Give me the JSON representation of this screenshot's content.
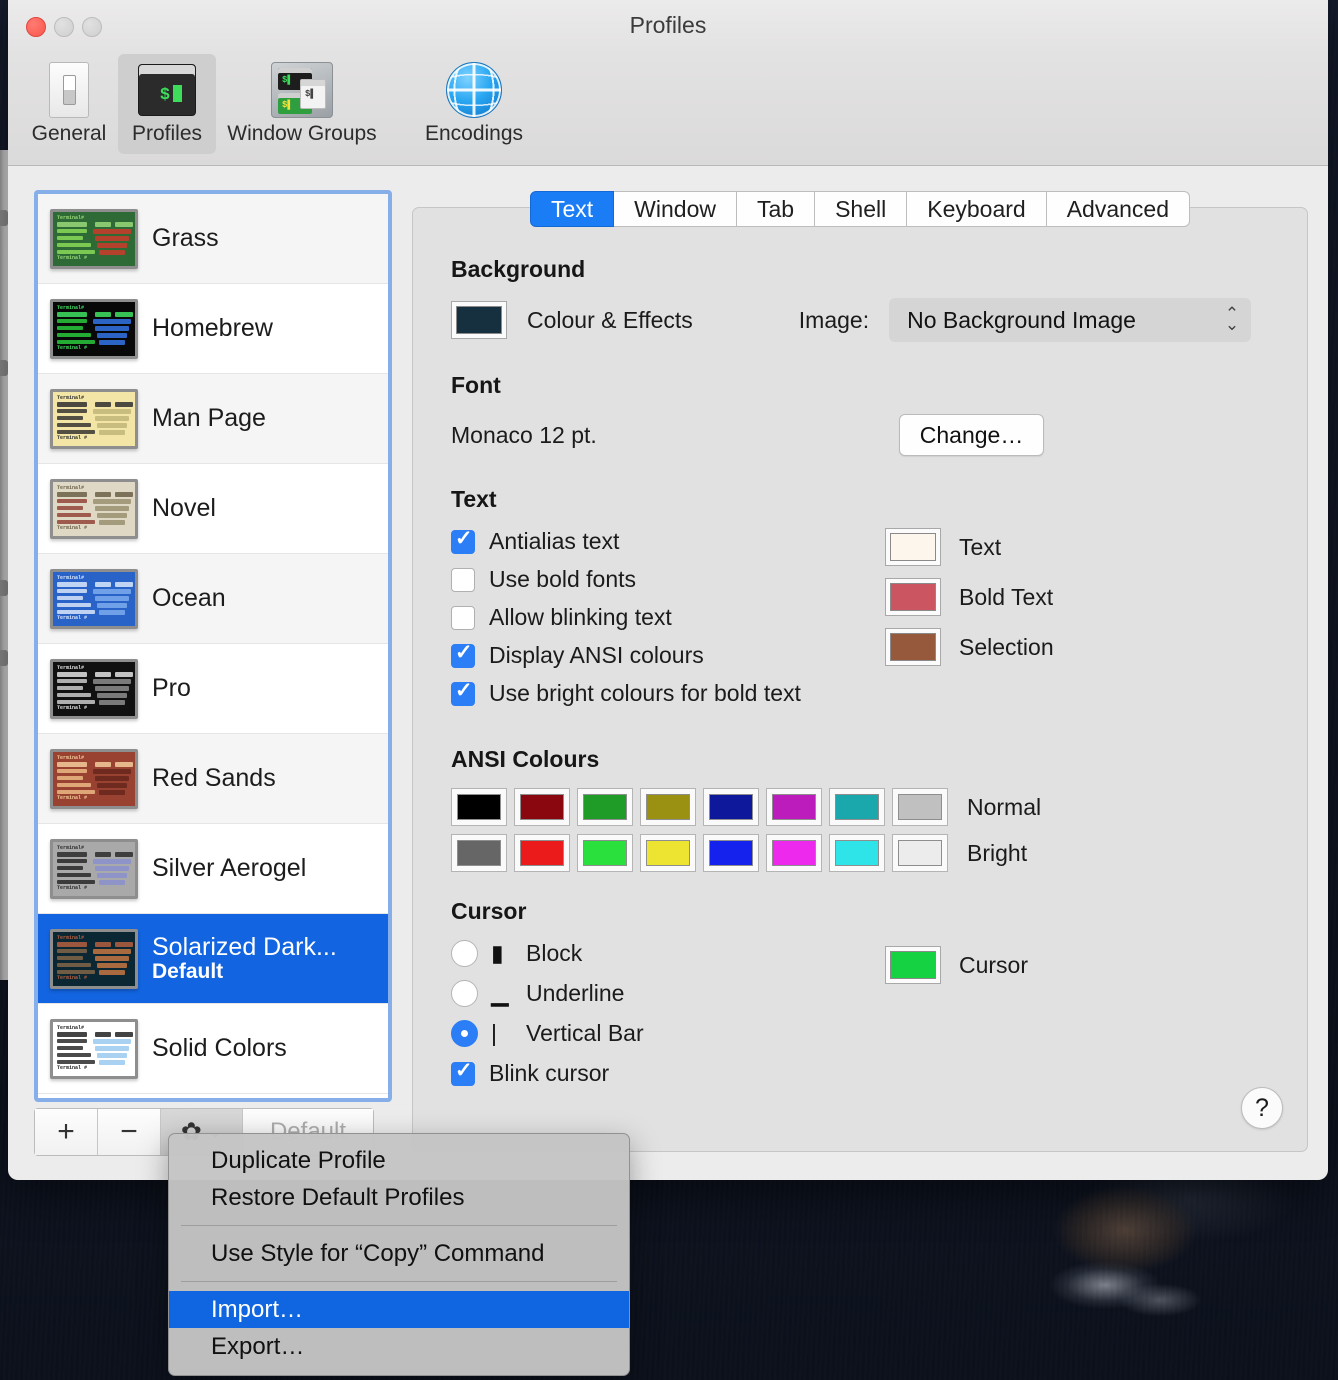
{
  "window": {
    "title": "Profiles"
  },
  "traffic_lights": [
    {
      "name": "close",
      "color": "#f9564c",
      "active": true
    },
    {
      "name": "minimize",
      "color": "#d2d2d2",
      "active": false
    },
    {
      "name": "zoom",
      "color": "#d2d2d2",
      "active": false
    }
  ],
  "toolbar": {
    "items": [
      {
        "label": "General",
        "icon": "general-switch-icon",
        "selected": false
      },
      {
        "label": "Profiles",
        "icon": "terminal-icon",
        "selected": true
      },
      {
        "label": "Window Groups",
        "icon": "window-groups-icon",
        "selected": false
      },
      {
        "label": "Encodings",
        "icon": "globe-icon",
        "selected": false
      }
    ]
  },
  "profile_list": {
    "items": [
      {
        "name": "Grass",
        "subtitle": "",
        "selected": false,
        "thumb": {
          "bg": "#2d6a35",
          "text": "#8fe05a",
          "accent": "#b4412c",
          "head": "#9bd87a"
        }
      },
      {
        "name": "Homebrew",
        "subtitle": "",
        "selected": false,
        "thumb": {
          "bg": "#080808",
          "text": "#2ad53f",
          "accent": "#2b64c4",
          "head": "#40e060"
        }
      },
      {
        "name": "Man Page",
        "subtitle": "",
        "selected": false,
        "thumb": {
          "bg": "#f3e5a6",
          "text": "#2a2a2a",
          "accent": "#c9bc7f",
          "head": "#2e2e2e"
        }
      },
      {
        "name": "Novel",
        "subtitle": "",
        "selected": false,
        "thumb": {
          "bg": "#dfd8c4",
          "text": "#8d3b2e",
          "accent": "#a49a7c",
          "head": "#6b5f46"
        }
      },
      {
        "name": "Ocean",
        "subtitle": "",
        "selected": false,
        "thumb": {
          "bg": "#2a63c8",
          "text": "#e6eefc",
          "accent": "#6fa0e8",
          "head": "#dbe7fb"
        }
      },
      {
        "name": "Pro",
        "subtitle": "",
        "selected": false,
        "thumb": {
          "bg": "#111111",
          "text": "#d6d6d6",
          "accent": "#7a7a7a",
          "head": "#e3e3e3"
        }
      },
      {
        "name": "Red Sands",
        "subtitle": "",
        "selected": false,
        "thumb": {
          "bg": "#9a4232",
          "text": "#f0c08a",
          "accent": "#6e2a1f",
          "head": "#f2cb9a"
        }
      },
      {
        "name": "Silver Aerogel",
        "subtitle": "",
        "selected": false,
        "thumb": {
          "bg": "#a9a9a9",
          "text": "#1f1f1f",
          "accent": "#8e93c8",
          "head": "#2b2b2b"
        }
      },
      {
        "name": "Solarized Dark...",
        "subtitle": "Default",
        "selected": true,
        "thumb": {
          "bg": "#0b2733",
          "text": "#8a6a4a",
          "accent": "#a86a3e",
          "head": "#b5603f"
        }
      },
      {
        "name": "Solid Colors",
        "subtitle": "",
        "selected": false,
        "thumb": {
          "bg": "#ffffff",
          "text": "#1e1e1e",
          "accent": "#a9d2f2",
          "head": "#222222"
        }
      }
    ],
    "toolbar": {
      "add_label": "+",
      "remove_label": "−",
      "gear_icon": "gear-icon",
      "chevron_icon": "chevron-down-icon",
      "default_label": "Default"
    }
  },
  "tabs": [
    {
      "label": "Text",
      "active": true
    },
    {
      "label": "Window",
      "active": false
    },
    {
      "label": "Tab",
      "active": false
    },
    {
      "label": "Shell",
      "active": false
    },
    {
      "label": "Keyboard",
      "active": false
    },
    {
      "label": "Advanced",
      "active": false
    }
  ],
  "background": {
    "heading": "Background",
    "colour_effects_label": "Colour & Effects",
    "colour_swatch": "#17303f",
    "image_label": "Image:",
    "image_value": "No Background Image"
  },
  "font": {
    "heading": "Font",
    "value": "Monaco 12 pt.",
    "change_label": "Change…"
  },
  "text": {
    "heading": "Text",
    "checkboxes": [
      {
        "label": "Antialias text",
        "checked": true
      },
      {
        "label": "Use bold fonts",
        "checked": false
      },
      {
        "label": "Allow blinking text",
        "checked": false
      },
      {
        "label": "Display ANSI colours",
        "checked": true
      },
      {
        "label": "Use bright colours for bold text",
        "checked": true
      }
    ],
    "colors": [
      {
        "label": "Text",
        "value": "#fdf6ec"
      },
      {
        "label": "Bold Text",
        "value": "#cb5560"
      },
      {
        "label": "Selection",
        "value": "#96593c"
      }
    ]
  },
  "ansi": {
    "heading": "ANSI Colours",
    "normal_label": "Normal",
    "bright_label": "Bright",
    "normal": [
      "#000000",
      "#8b0710",
      "#1f9b28",
      "#9a9112",
      "#0d189b",
      "#bc1cbc",
      "#1ba8ad",
      "#c0c0c0"
    ],
    "bright": [
      "#666666",
      "#ec1b1b",
      "#2ae03c",
      "#ece430",
      "#1522ed",
      "#ec29ec",
      "#2ee4e8",
      "#ececec"
    ]
  },
  "cursor": {
    "heading": "Cursor",
    "options": [
      {
        "label": "Block",
        "glyph": "▮",
        "selected": false
      },
      {
        "label": "Underline",
        "glyph": "▁",
        "selected": false
      },
      {
        "label": "Vertical Bar",
        "glyph": "|",
        "selected": true
      }
    ],
    "blink": {
      "label": "Blink cursor",
      "checked": true
    },
    "color": {
      "label": "Cursor",
      "value": "#14d241"
    }
  },
  "help": {
    "label": "?"
  },
  "menu": {
    "items": [
      {
        "label": "Duplicate Profile",
        "type": "item",
        "highlighted": false
      },
      {
        "label": "Restore Default Profiles",
        "type": "item",
        "highlighted": false
      },
      {
        "label": "",
        "type": "separator",
        "highlighted": false
      },
      {
        "label": "Use Style for “Copy” Command",
        "type": "item",
        "highlighted": false
      },
      {
        "label": "",
        "type": "separator",
        "highlighted": false
      },
      {
        "label": "Import…",
        "type": "item",
        "highlighted": true
      },
      {
        "label": "Export…",
        "type": "item",
        "highlighted": false
      }
    ]
  }
}
